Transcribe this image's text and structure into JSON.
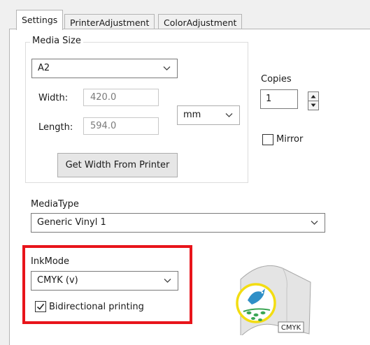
{
  "tabs": [
    {
      "label": "Settings",
      "active": true
    },
    {
      "label": "PrinterAdjustment",
      "active": false
    },
    {
      "label": "ColorAdjustment",
      "active": false
    }
  ],
  "media_size": {
    "group_label": "Media Size",
    "size_value": "A2",
    "width_label": "Width:",
    "width_value": "420.0",
    "length_label": "Length:",
    "length_value": "594.0",
    "unit_value": "mm",
    "get_width_button": "Get Width From Printer"
  },
  "copies": {
    "label": "Copies",
    "value": "1"
  },
  "mirror": {
    "label": "Mirror",
    "checked": false
  },
  "media_type": {
    "label": "MediaType",
    "value": "Generic Vinyl 1"
  },
  "ink_mode": {
    "label": "InkMode",
    "value": "CMYK (v)",
    "bidirectional_label": "Bidirectional printing",
    "bidirectional_checked": true
  },
  "graphic": {
    "badge": "CMYK"
  },
  "colors": {
    "highlight": "#e8141b",
    "media_sheet": "#e4e4e4",
    "logo_ring": "#f3dd12",
    "bird": "#2f8fc7",
    "leaf": "#3aa553"
  },
  "icons": [
    "chevron-down-icon",
    "spin-up-icon",
    "spin-down-icon",
    "checkmark-icon",
    "media-bird-icon"
  ]
}
